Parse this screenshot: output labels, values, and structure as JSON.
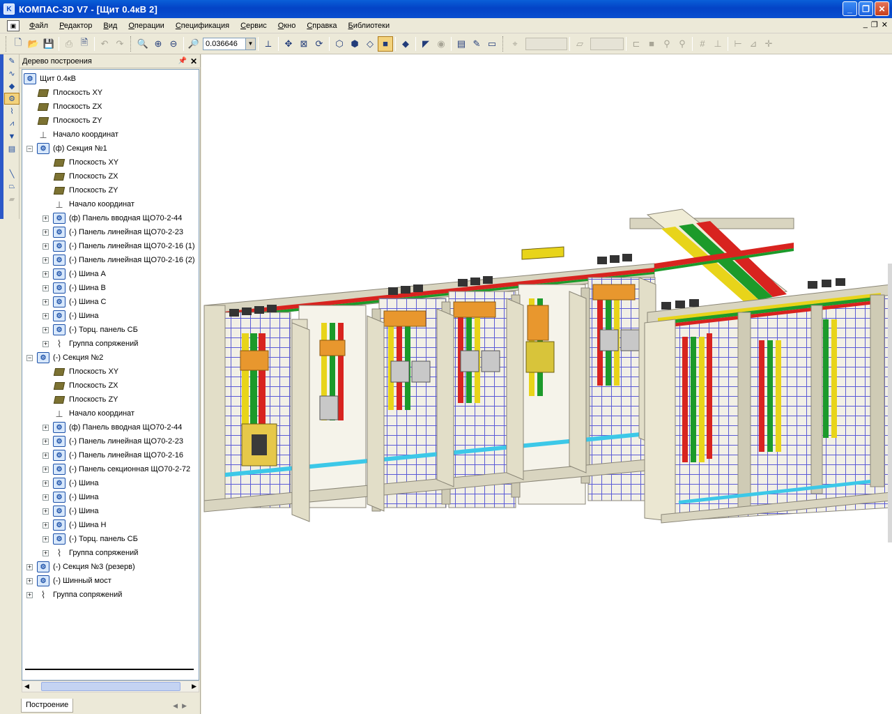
{
  "titlebar": {
    "title": "КОМПАС-3D V7 - [Щит 0.4кВ 2]"
  },
  "menu": [
    "Файл",
    "Редактор",
    "Вид",
    "Операции",
    "Спецификация",
    "Сервис",
    "Окно",
    "Справка",
    "Библиотеки"
  ],
  "toolbar": {
    "zoom_value": "0.036646"
  },
  "tree": {
    "title": "Дерево построения",
    "tab": "Построение",
    "rows": [
      {
        "level": 0,
        "toggle": "",
        "icon": "asm",
        "label": "Щит 0.4кВ"
      },
      {
        "level": 1,
        "toggle": "",
        "icon": "plane",
        "label": "Плоскость XY"
      },
      {
        "level": 1,
        "toggle": "",
        "icon": "plane",
        "label": "Плоскость ZX"
      },
      {
        "level": 1,
        "toggle": "",
        "icon": "plane",
        "label": "Плоскость ZY"
      },
      {
        "level": 1,
        "toggle": "",
        "icon": "origin",
        "label": "Начало координат"
      },
      {
        "level": 1,
        "toggle": "−",
        "icon": "asm",
        "label": "(ф) Секция №1"
      },
      {
        "level": 2,
        "toggle": "",
        "icon": "plane",
        "label": "Плоскость XY"
      },
      {
        "level": 2,
        "toggle": "",
        "icon": "plane",
        "label": "Плоскость ZX"
      },
      {
        "level": 2,
        "toggle": "",
        "icon": "plane",
        "label": "Плоскость ZY"
      },
      {
        "level": 2,
        "toggle": "",
        "icon": "origin",
        "label": "Начало координат"
      },
      {
        "level": 2,
        "toggle": "+",
        "icon": "asm",
        "label": "(ф) Панель вводная ЩО70-2-44"
      },
      {
        "level": 2,
        "toggle": "+",
        "icon": "asm",
        "label": "(-) Панель линейная ЩО70-2-23"
      },
      {
        "level": 2,
        "toggle": "+",
        "icon": "asm",
        "label": "(-) Панель линейная ЩО70-2-16 (1)"
      },
      {
        "level": 2,
        "toggle": "+",
        "icon": "asm",
        "label": "(-) Панель линейная ЩО70-2-16 (2)"
      },
      {
        "level": 2,
        "toggle": "+",
        "icon": "asm",
        "label": "(-) Шина А"
      },
      {
        "level": 2,
        "toggle": "+",
        "icon": "asm",
        "label": "(-) Шина В"
      },
      {
        "level": 2,
        "toggle": "+",
        "icon": "asm",
        "label": "(-) Шина С"
      },
      {
        "level": 2,
        "toggle": "+",
        "icon": "asm",
        "label": "(-) Шина"
      },
      {
        "level": 2,
        "toggle": "+",
        "icon": "asm",
        "label": "(-) Торц. панель СБ"
      },
      {
        "level": 2,
        "toggle": "+",
        "icon": "mate",
        "label": "Группа сопряжений"
      },
      {
        "level": 1,
        "toggle": "−",
        "icon": "asm",
        "label": "(-) Секция №2"
      },
      {
        "level": 2,
        "toggle": "",
        "icon": "plane",
        "label": "Плоскость XY"
      },
      {
        "level": 2,
        "toggle": "",
        "icon": "plane",
        "label": "Плоскость ZX"
      },
      {
        "level": 2,
        "toggle": "",
        "icon": "plane",
        "label": "Плоскость ZY"
      },
      {
        "level": 2,
        "toggle": "",
        "icon": "origin",
        "label": "Начало координат"
      },
      {
        "level": 2,
        "toggle": "+",
        "icon": "asm",
        "label": "(ф) Панель вводная ЩО70-2-44"
      },
      {
        "level": 2,
        "toggle": "+",
        "icon": "asm",
        "label": "(-) Панель линейная ЩО70-2-23"
      },
      {
        "level": 2,
        "toggle": "+",
        "icon": "asm",
        "label": "(-) Панель линейная ЩО70-2-16"
      },
      {
        "level": 2,
        "toggle": "+",
        "icon": "asm",
        "label": "(-) Панель секционная ЩО70-2-72"
      },
      {
        "level": 2,
        "toggle": "+",
        "icon": "asm",
        "label": "(-) Шина"
      },
      {
        "level": 2,
        "toggle": "+",
        "icon": "asm",
        "label": "(-) Шина"
      },
      {
        "level": 2,
        "toggle": "+",
        "icon": "asm",
        "label": "(-) Шина"
      },
      {
        "level": 2,
        "toggle": "+",
        "icon": "asm",
        "label": "(-) Шина Н"
      },
      {
        "level": 2,
        "toggle": "+",
        "icon": "asm",
        "label": "(-) Торц. панель СБ"
      },
      {
        "level": 2,
        "toggle": "+",
        "icon": "mate",
        "label": "Группа сопряжений"
      },
      {
        "level": 1,
        "toggle": "+",
        "icon": "asm",
        "label": "(-) Секция №3 (резерв)"
      },
      {
        "level": 1,
        "toggle": "+",
        "icon": "asm",
        "label": "(-) Шинный мост"
      },
      {
        "level": 1,
        "toggle": "+",
        "icon": "mate",
        "label": "Группа сопряжений"
      }
    ]
  },
  "colors": {
    "titlebar": "#0343c6",
    "phase_a": "#e8d41a",
    "phase_b": "#1c9a2a",
    "phase_c": "#d8231f",
    "frame": "#dedac4",
    "rail": "#4a4ad0",
    "neutral": "#3cc8e8"
  }
}
